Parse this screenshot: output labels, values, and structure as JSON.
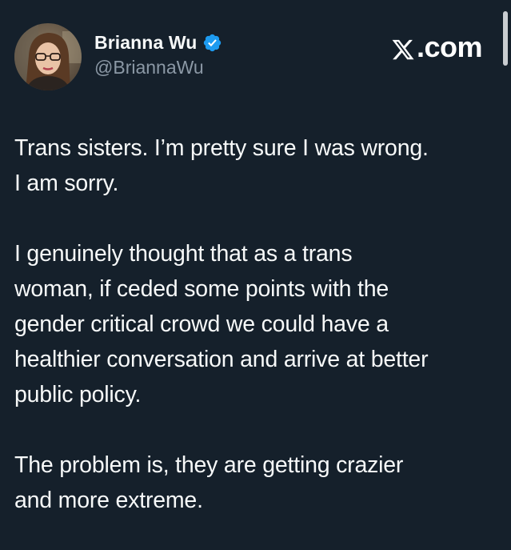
{
  "author": {
    "display_name": "Brianna Wu",
    "handle": "@BriannaWu",
    "verified": true,
    "verified_color": "#1d9bf0",
    "avatar_icon": "profile-photo"
  },
  "site": {
    "logo_text": ".com",
    "logo_icon": "x-logo-icon"
  },
  "tweet": {
    "paragraphs": [
      "Trans sisters. I’m pretty sure I was wrong.\nI am sorry.",
      "I genuinely thought that as a trans\nwoman, if ceded some points with the\ngender critical crowd we could have a\nhealthier conversation and arrive at better\npublic policy.",
      "The problem is, they are getting crazier\nand more extreme."
    ]
  },
  "theme": {
    "background": "#15202b",
    "text": "#f7f9f9",
    "secondary_text": "#8b98a5"
  }
}
